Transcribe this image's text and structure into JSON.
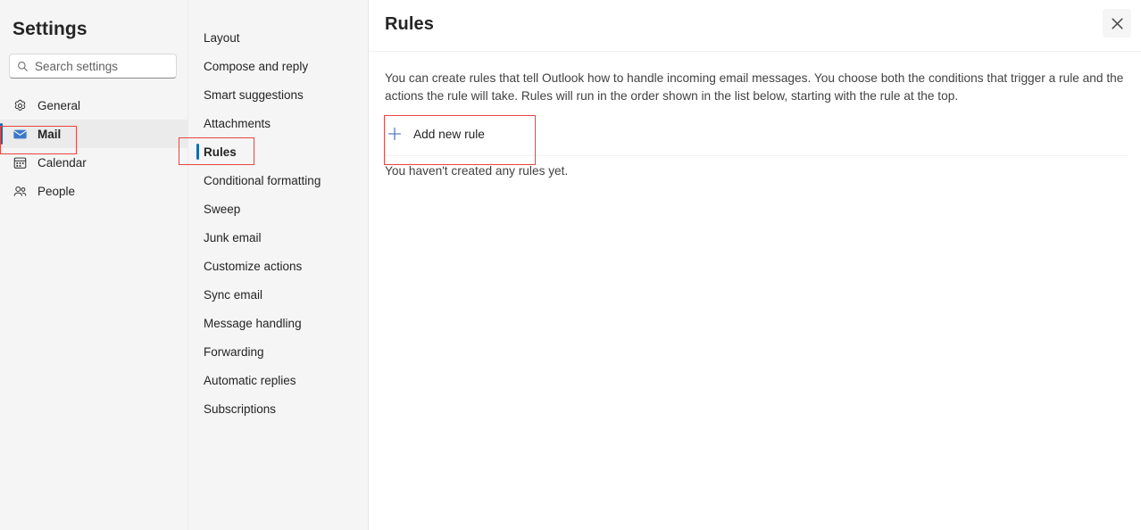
{
  "dialog": {
    "title": "Settings",
    "close_label": "Close",
    "close_icon": "close-icon"
  },
  "search": {
    "placeholder": "Search settings",
    "value": "",
    "icon": "search-icon"
  },
  "sidebar": {
    "items": [
      {
        "label": "General",
        "icon": "gear-icon",
        "selected": false
      },
      {
        "label": "Mail",
        "icon": "mail-icon",
        "selected": true
      },
      {
        "label": "Calendar",
        "icon": "calendar-icon",
        "selected": false
      },
      {
        "label": "People",
        "icon": "people-icon",
        "selected": false
      }
    ]
  },
  "navcol": {
    "items": [
      {
        "label": "Layout",
        "selected": false
      },
      {
        "label": "Compose and reply",
        "selected": false
      },
      {
        "label": "Smart suggestions",
        "selected": false
      },
      {
        "label": "Attachments",
        "selected": false
      },
      {
        "label": "Rules",
        "selected": true
      },
      {
        "label": "Conditional formatting",
        "selected": false
      },
      {
        "label": "Sweep",
        "selected": false
      },
      {
        "label": "Junk email",
        "selected": false
      },
      {
        "label": "Customize actions",
        "selected": false
      },
      {
        "label": "Sync email",
        "selected": false
      },
      {
        "label": "Message handling",
        "selected": false
      },
      {
        "label": "Forwarding",
        "selected": false
      },
      {
        "label": "Automatic replies",
        "selected": false
      },
      {
        "label": "Subscriptions",
        "selected": false
      }
    ]
  },
  "main": {
    "title": "Rules",
    "description": "You can create rules that tell Outlook how to handle incoming email messages. You choose both the conditions that trigger a rule and the actions the rule will take. Rules will run in the order shown in the list below, starting with the rule at the top.",
    "add_new_rule_label": "Add new rule",
    "add_new_rule_icon": "plus-icon",
    "empty_state": "You haven't created any rules yet."
  },
  "colors": {
    "accent_blue": "#0f6cbd",
    "annotation_red": "#e8453c",
    "panel_gray": "#f5f5f5",
    "selected_row_gray": "#ebebeb",
    "text_primary": "#242424",
    "text_secondary": "#424242"
  },
  "annotations": [
    {
      "target": "sidebar-item-mail",
      "color": "#e8453c"
    },
    {
      "target": "nav-item-rules",
      "color": "#e8453c"
    },
    {
      "target": "add-new-rule-button",
      "color": "#e8453c"
    }
  ]
}
